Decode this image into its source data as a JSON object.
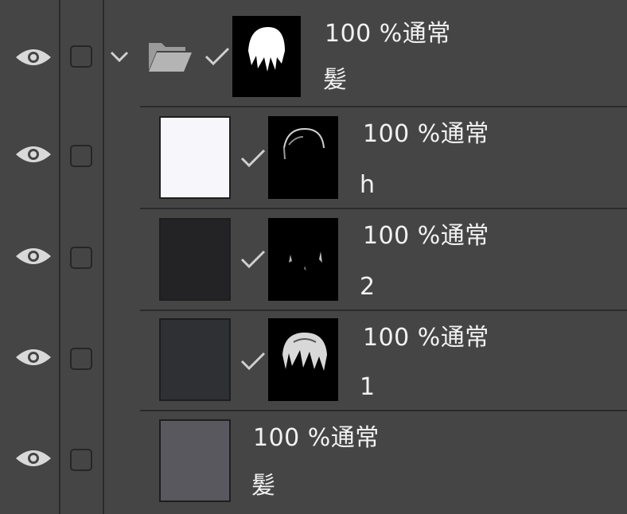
{
  "layers": [
    {
      "id": "group",
      "type": "folder",
      "blend": "100 %通常",
      "name": "髪",
      "expanded": true,
      "has_mask": true,
      "visible": true,
      "icons": {
        "visibility": "eye-icon",
        "expand": "chevron-down-icon",
        "folder": "folder-icon",
        "mask_link": "check-icon"
      }
    },
    {
      "id": "h",
      "type": "layer",
      "blend": "100 %通常",
      "name": "h",
      "thumb_color": "#f7f7fb",
      "has_mask": true,
      "visible": true
    },
    {
      "id": "2",
      "type": "layer",
      "blend": "100 %通常",
      "name": "2",
      "thumb_color": "#232325",
      "has_mask": true,
      "visible": true
    },
    {
      "id": "1",
      "type": "layer",
      "blend": "100 %通常",
      "name": "1",
      "thumb_color": "#2f3034",
      "has_mask": true,
      "visible": true
    },
    {
      "id": "base",
      "type": "layer",
      "blend": "100 %通常",
      "name": "髪",
      "thumb_color": "#58585e",
      "has_mask": false,
      "visible": true
    }
  ],
  "colors": {
    "panel_bg": "#454545",
    "separator": "#2b2b2b",
    "text": "#f2f2f2",
    "icon": "#d9d9d9"
  }
}
